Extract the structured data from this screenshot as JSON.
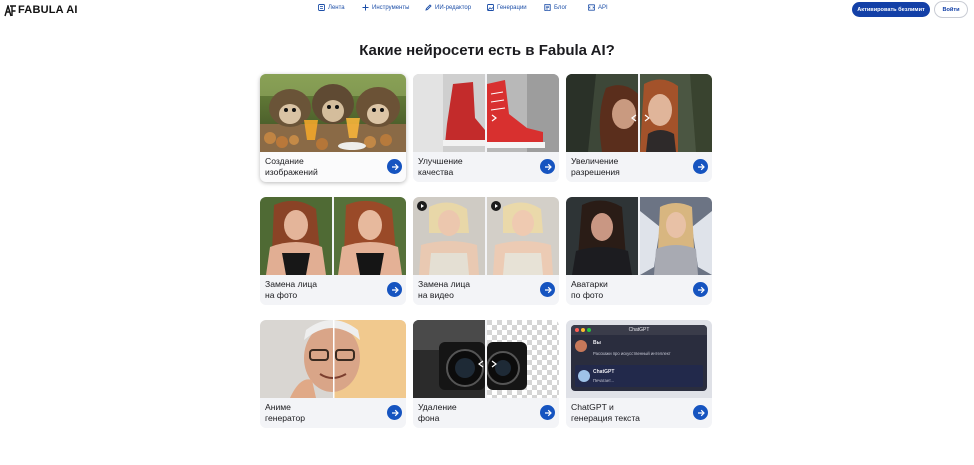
{
  "header": {
    "logo_text": "FABULA AI",
    "nav": [
      {
        "label": "Лента",
        "icon": "feed-icon"
      },
      {
        "label": "Инструменты",
        "icon": "plus-icon"
      },
      {
        "label": "ИИ-редактор",
        "icon": "pencil-icon"
      },
      {
        "label": "Генерации",
        "icon": "image-icon"
      },
      {
        "label": "Блог",
        "icon": "document-icon"
      },
      {
        "label": "API",
        "icon": "api-icon"
      }
    ],
    "cta_label": "Активировать безлимит",
    "login_label": "Войти"
  },
  "main": {
    "title": "Какие нейросети есть в Fabula AI?",
    "cards": [
      {
        "label": "Создание\nизображений"
      },
      {
        "label": "Улучшение\nкачества"
      },
      {
        "label": "Увеличение\nразрешения"
      },
      {
        "label": "Замена лица\nна фото"
      },
      {
        "label": "Замена лица\nна видео"
      },
      {
        "label": "Аватарки\nпо фото"
      },
      {
        "label": "Аниме\nгенератор"
      },
      {
        "label": "Удаление\nфона"
      },
      {
        "label": "ChatGPT и\nгенерация текста"
      }
    ]
  },
  "chat_preview": {
    "window_title": "ChatGPT",
    "user_name": "Вы",
    "user_message": "Расскажи про искусственный интеллект",
    "bot_name": "ChatGPT",
    "bot_status": "Печатает..."
  },
  "colors": {
    "accent": "#1654c0",
    "cta": "#1340a7",
    "nav_text": "#1d4fa8",
    "card_bg": "#f3f4f7"
  }
}
